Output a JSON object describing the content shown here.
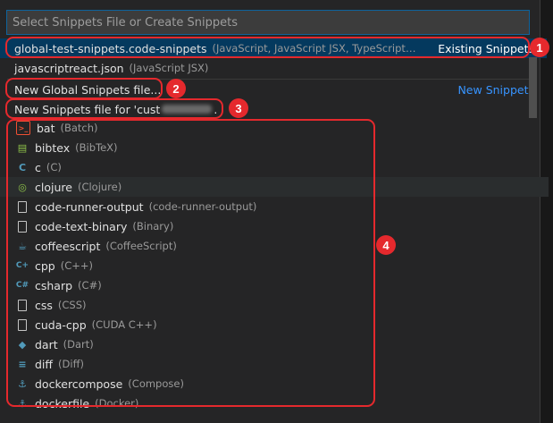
{
  "search": {
    "placeholder": "Select Snippets File or Create Snippets"
  },
  "existing": [
    {
      "label": "global-test-snippets.code-snippets",
      "desc": "(JavaScript, JavaScript JSX, TypeScript…",
      "right": "Existing Snippets"
    },
    {
      "label": "javascriptreact.json",
      "desc": "(JavaScript JSX)"
    }
  ],
  "new": {
    "global_label": "New Global Snippets file...",
    "right": "New Snippets",
    "for_label_prefix": "New Snippets file for 'cust",
    "for_label_suffix": "."
  },
  "languages": [
    {
      "label": "bat",
      "desc": "(Batch)",
      "icon": "terminal-icon",
      "color": "#f05033"
    },
    {
      "label": "bibtex",
      "desc": "(BibTeX)",
      "icon": "bibtex-icon",
      "color": "#8dc149"
    },
    {
      "label": "c",
      "desc": "(C)",
      "icon": "c-icon",
      "color": "#519aba"
    },
    {
      "label": "clojure",
      "desc": "(Clojure)",
      "icon": "clojure-icon",
      "color": "#8dc149"
    },
    {
      "label": "code-runner-output",
      "desc": "(code-runner-output)",
      "icon": "file-icon",
      "color": "#c5c5c5"
    },
    {
      "label": "code-text-binary",
      "desc": "(Binary)",
      "icon": "file-icon",
      "color": "#c5c5c5"
    },
    {
      "label": "coffeescript",
      "desc": "(CoffeeScript)",
      "icon": "coffee-icon",
      "color": "#519aba"
    },
    {
      "label": "cpp",
      "desc": "(C++)",
      "icon": "cpp-icon",
      "color": "#519aba"
    },
    {
      "label": "csharp",
      "desc": "(C#)",
      "icon": "csharp-icon",
      "color": "#519aba"
    },
    {
      "label": "css",
      "desc": "(CSS)",
      "icon": "file-icon",
      "color": "#c5c5c5"
    },
    {
      "label": "cuda-cpp",
      "desc": "(CUDA C++)",
      "icon": "file-icon",
      "color": "#c5c5c5"
    },
    {
      "label": "dart",
      "desc": "(Dart)",
      "icon": "dart-icon",
      "color": "#519aba"
    },
    {
      "label": "diff",
      "desc": "(Diff)",
      "icon": "diff-icon",
      "color": "#519aba"
    },
    {
      "label": "dockercompose",
      "desc": "(Compose)",
      "icon": "docker-icon",
      "color": "#519aba"
    },
    {
      "label": "dockerfile",
      "desc": "(Docker)",
      "icon": "docker-icon",
      "color": "#519aba"
    }
  ],
  "annotations": [
    "1",
    "2",
    "3",
    "4"
  ],
  "colors": {
    "accent": "#0e639c",
    "selection": "#04395e",
    "link": "#3794ff",
    "annotation": "#e5292d"
  }
}
